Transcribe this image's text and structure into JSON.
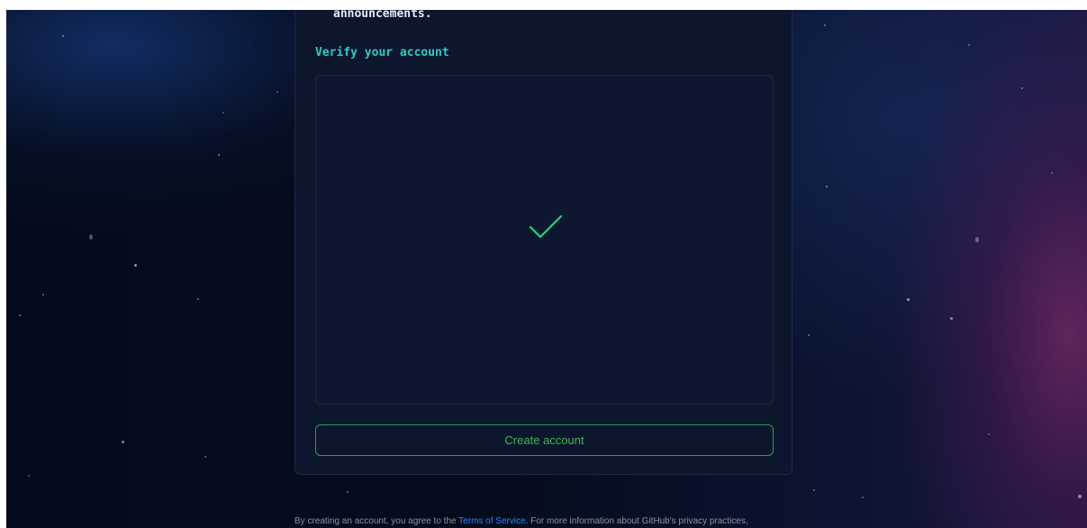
{
  "signup": {
    "announcement_fragment": "announcements.",
    "verify_heading": "Verify your account",
    "verification_status_icon": "checkmark-icon",
    "create_account_label": "Create account"
  },
  "footer": {
    "prefix": "By creating an account, you agree to the ",
    "terms_link": "Terms of Service",
    "suffix": ". For more information about GitHub's privacy practices,"
  },
  "colors": {
    "accent_teal": "#2ecbc0",
    "success_green": "#3fb950",
    "link_blue": "#2f81f7",
    "card_bg": "#0c162d"
  }
}
